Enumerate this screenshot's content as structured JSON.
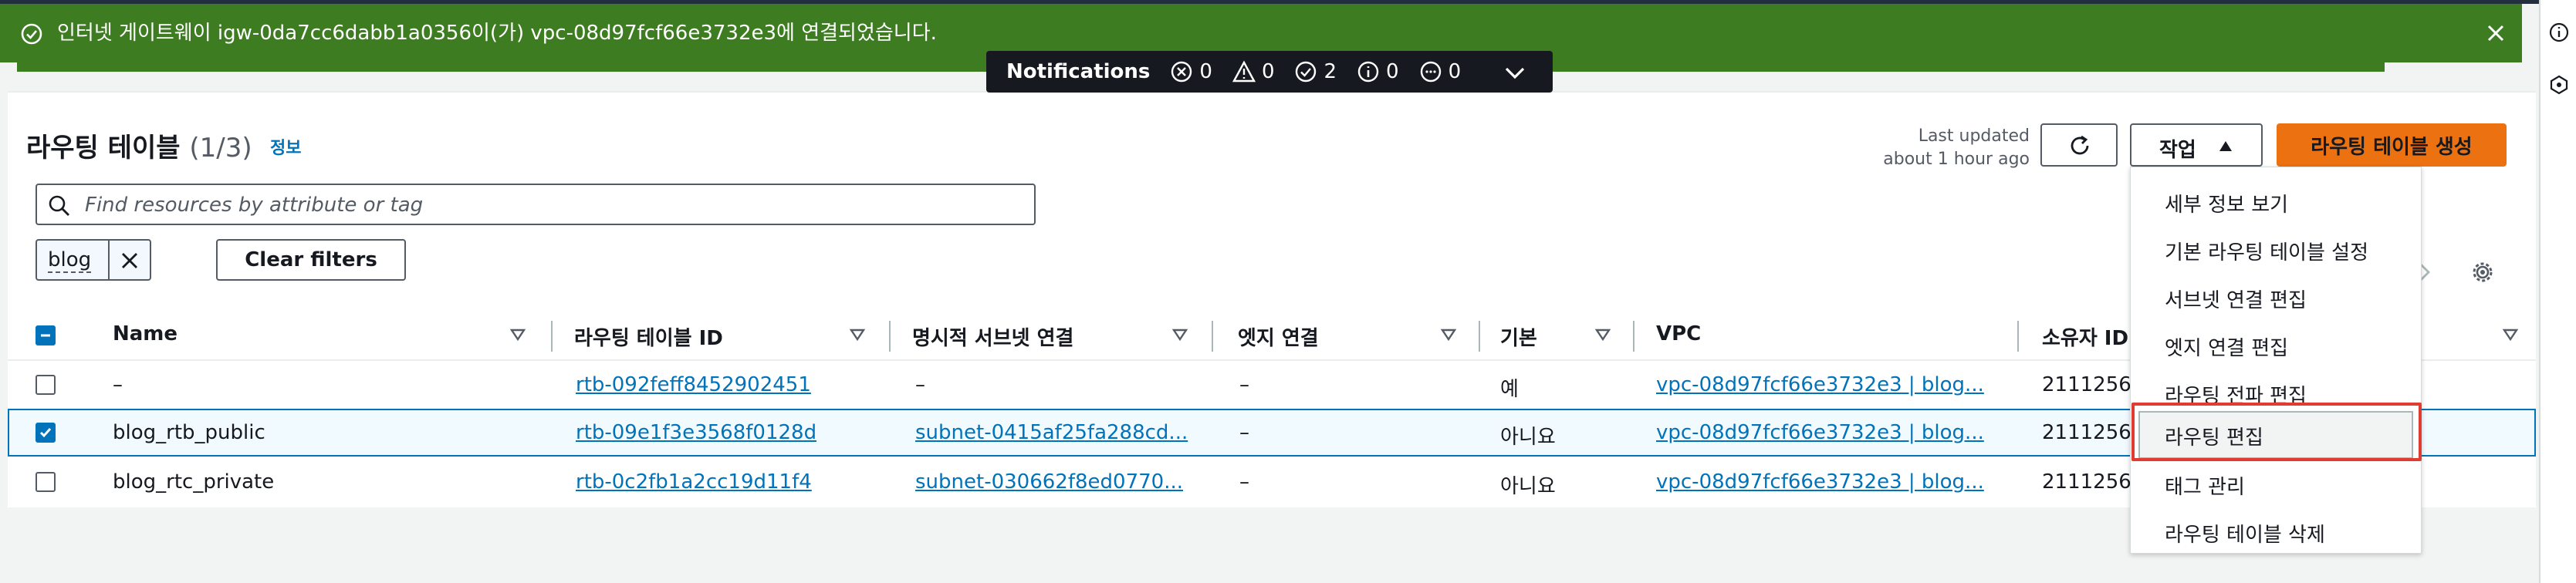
{
  "flash": {
    "message": "인터넷 게이트웨이 igw-0da7cc6dabb1a0356이(가) vpc-08d97fcf66e3732e3에 연결되었습니다."
  },
  "notifications": {
    "title": "Notifications",
    "error_count": "0",
    "warning_count": "0",
    "success_count": "2",
    "info_count": "0",
    "pending_count": "0"
  },
  "header": {
    "title": "라우팅 테이블",
    "count": "(1/3)",
    "info_label": "정보",
    "last_updated_line1": "Last updated",
    "last_updated_line2": "about 1 hour ago",
    "actions_label": "작업",
    "create_label": "라우팅 테이블 생성"
  },
  "search": {
    "placeholder": "Find resources by attribute or tag",
    "value": ""
  },
  "filter": {
    "token": "blog",
    "clear_label": "Clear filters"
  },
  "table": {
    "columns": [
      "Name",
      "라우팅 테이블 ID",
      "명시적 서브넷 연결",
      "엣지 연결",
      "기본",
      "VPC",
      "소유자 ID"
    ],
    "rows": [
      {
        "selected": false,
        "name": "–",
        "rt_id": "rtb-092feff8452902451",
        "subnet": "–",
        "edge": "–",
        "main": "예",
        "vpc": "vpc-08d97fcf66e3732e3 | blog...",
        "owner": "2111256"
      },
      {
        "selected": true,
        "name": "blog_rtb_public",
        "rt_id": "rtb-09e1f3e3568f0128d",
        "subnet": "subnet-0415af25fa288cd...",
        "edge": "–",
        "main": "아니요",
        "vpc": "vpc-08d97fcf66e3732e3 | blog...",
        "owner": "2111256"
      },
      {
        "selected": false,
        "name": "blog_rtc_private",
        "rt_id": "rtb-0c2fb1a2cc19d11f4",
        "subnet": "subnet-030662f8ed0770...",
        "edge": "–",
        "main": "아니요",
        "vpc": "vpc-08d97fcf66e3732e3 | blog...",
        "owner": "2111256"
      }
    ]
  },
  "actions_menu": {
    "items": [
      "세부 정보 보기",
      "기본 라우팅 테이블 설정",
      "서브넷 연결 편집",
      "엣지 연결 편집",
      "라우팅 전파 편집",
      "라우팅 편집",
      "태그 관리",
      "라우팅 테이블 삭제"
    ],
    "highlighted_index": 5
  },
  "colors": {
    "flash_bg": "#3d7c21",
    "primary": "#ec7211",
    "link": "#0073bb",
    "highlight_outline": "#e03c31"
  }
}
